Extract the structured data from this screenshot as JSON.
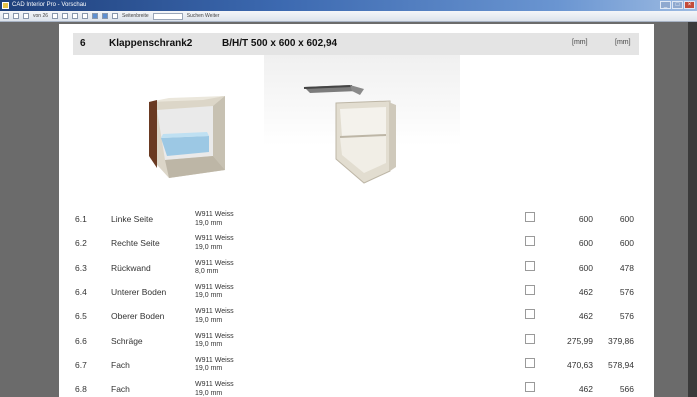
{
  "window": {
    "title": "CAD Interior Pro - Vorschau"
  },
  "toolbar": {
    "page_label": "von 26",
    "zoom_label": "Seitenbreite",
    "search_placeholder": "Suchen   Weiter"
  },
  "header": {
    "number": "6",
    "name": "Klappenschrank2",
    "dims": "B/H/T 500 x 600 x 602,94",
    "unit1": "[mm]",
    "unit2": "[mm]"
  },
  "rows": [
    {
      "num": "6.1",
      "name": "Linke Seite",
      "mat1": "W911 Weiss",
      "mat2": "19,0 mm",
      "v1": "600",
      "v2": "600"
    },
    {
      "num": "6.2",
      "name": "Rechte Seite",
      "mat1": "W911 Weiss",
      "mat2": "19,0 mm",
      "v1": "600",
      "v2": "600"
    },
    {
      "num": "6.3",
      "name": "Rückwand",
      "mat1": "W911 Weiss",
      "mat2": "8,0 mm",
      "v1": "600",
      "v2": "478"
    },
    {
      "num": "6.4",
      "name": "Unterer Boden",
      "mat1": "W911 Weiss",
      "mat2": "19,0 mm",
      "v1": "462",
      "v2": "576"
    },
    {
      "num": "6.5",
      "name": "Oberer Boden",
      "mat1": "W911 Weiss",
      "mat2": "19,0 mm",
      "v1": "462",
      "v2": "576"
    },
    {
      "num": "6.6",
      "name": "Schräge",
      "mat1": "W911 Weiss",
      "mat2": "19,0 mm",
      "v1": "275,99",
      "v2": "379,86"
    },
    {
      "num": "6.7",
      "name": "Fach",
      "mat1": "W911 Weiss",
      "mat2": "19,0 mm",
      "v1": "470,63",
      "v2": "578,94"
    },
    {
      "num": "6.8",
      "name": "Fach",
      "mat1": "W911 Weiss",
      "mat2": "19,0 mm",
      "v1": "462",
      "v2": "566"
    }
  ]
}
